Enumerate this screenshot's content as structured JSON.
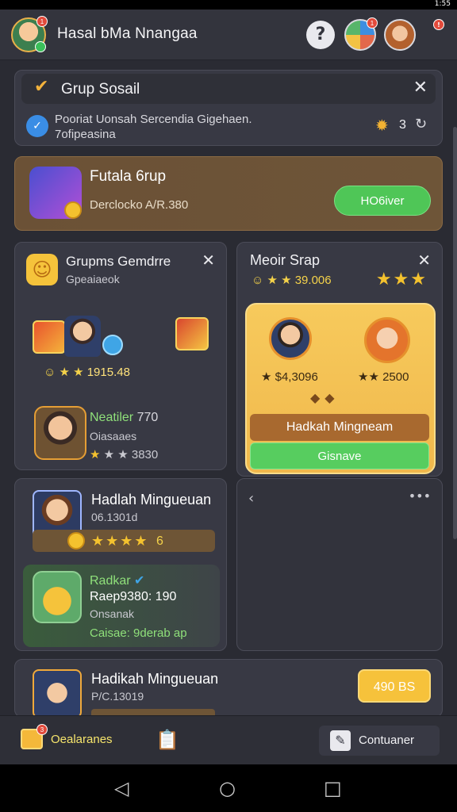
{
  "status_bar": {
    "time": "1:55"
  },
  "header": {
    "title": "Hasal bMa Nnangaa",
    "avatar_badge": "1",
    "apps_badge": "1",
    "alert_badge": "!",
    "help_glyph": "?"
  },
  "group_card": {
    "title": "Grup Sosail",
    "description_line1": "Pooriat Uonsah Sercendia Gigehaen.",
    "description_line2": "7ofipeasina",
    "count": "3"
  },
  "featured": {
    "title": "Futala 6rup",
    "subtitle": "Derclocko A/R.380",
    "button_label": "HO6iver"
  },
  "left_col": {
    "title": "Grupms Gemdrre",
    "subtitle": "Gpeaiaeok",
    "rating_value": "1915.48",
    "member_name": "Neatiler",
    "member_extra": "770",
    "member_sub": "Oiasaaes",
    "member_rating": "3830"
  },
  "right_col": {
    "title": "Meoir Srap",
    "rating_value": "39.006",
    "value_left": "$4,3096",
    "value_right": "2500",
    "bar_label": "Hadkah Mingneam",
    "button_label": "Gisnave"
  },
  "weekly_card": {
    "title": "Hadlah Mingueuan",
    "subtitle": "06.1301d",
    "stars_value": "6",
    "member_name": "Radkar",
    "member_value": "Raep9380: 190",
    "member_sub": "Onsanak",
    "member_category": "Caisae: 9derab ap"
  },
  "bottom_card": {
    "title": "Hadikah Mingueuan",
    "subtitle": "P/C.13019",
    "button_label": "490 BS"
  },
  "bottom_nav": {
    "left_label": "Oealaranes",
    "left_badge": "3",
    "right_label": "Contuaner"
  }
}
